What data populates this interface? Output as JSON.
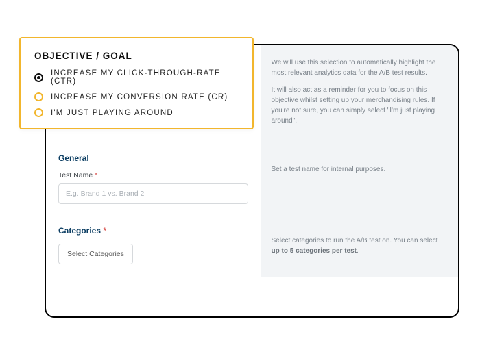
{
  "objective": {
    "title": "OBJECTIVE / GOAL",
    "options": [
      {
        "label": "INCREASE MY CLICK-THROUGH-RATE (CTR)",
        "selected": true
      },
      {
        "label": "INCREASE MY CONVERSION RATE (CR)",
        "selected": false
      },
      {
        "label": "I'M JUST PLAYING AROUND",
        "selected": false
      }
    ],
    "help_p1": "We will use this selection to automatically highlight the most relevant analytics data for the A/B test results.",
    "help_p2": "It will also act as a reminder for you to focus on this objective whilst setting up your merchandising rules. If you're not sure, you can simply select \"I'm just playing around\"."
  },
  "general": {
    "title": "General",
    "test_name_label": "Test Name",
    "required_mark": "*",
    "test_name_placeholder": "E.g. Brand 1 vs. Brand 2",
    "help": "Set a test name for internal purposes."
  },
  "categories": {
    "title": "Categories",
    "required_mark": "*",
    "button_label": "Select Categories",
    "help_prefix": "Select categories to run the A/B test on. You can select ",
    "help_strong": "up to 5 categories per test",
    "help_suffix": "."
  }
}
